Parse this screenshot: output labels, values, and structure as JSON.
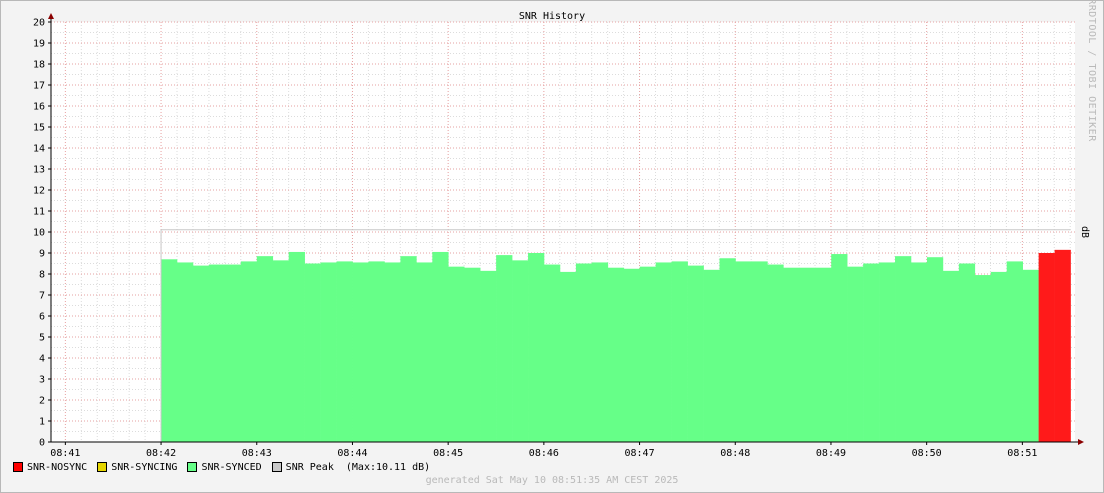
{
  "window": {
    "title": "SNR History",
    "unit_label": "dB",
    "watermark": "RRDTOOL / TOBI OETIKER",
    "footer": "generated Sat May 10 08:51:35 AM CEST 2025"
  },
  "colors": {
    "background": "#f3f3f3",
    "canvas": "#ffffff",
    "grid_major": "#e6a0a0",
    "grid_minor": "#dcdcdc",
    "synced": "#66ff88",
    "nosync": "#ff1a1a",
    "syncing": "#e0d000",
    "peak": "#c8c8c8",
    "axis": "#000000",
    "arrow": "#8b0000"
  },
  "legend": [
    {
      "label": "SNR-NOSYNC",
      "color": "#ff0000"
    },
    {
      "label": "SNR-SYNCING",
      "color": "#e6d600"
    },
    {
      "label": "SNR-SYNCED",
      "color": "#66ff88"
    },
    {
      "label": "SNR Peak  (Max:10.11 dB)",
      "color": "#c8c8c8"
    }
  ],
  "chart_data": {
    "type": "bar",
    "title": "SNR History",
    "ylabel": "dB",
    "ylim": [
      0,
      20
    ],
    "y_ticks": [
      0,
      1,
      2,
      3,
      4,
      5,
      6,
      7,
      8,
      9,
      10,
      11,
      12,
      13,
      14,
      15,
      16,
      17,
      18,
      19,
      20
    ],
    "x_range_minutes": [
      8.525,
      9.1
    ],
    "x_ticks": [
      {
        "label": "08:41",
        "value": 41
      },
      {
        "label": "08:42",
        "value": 42
      },
      {
        "label": "08:43",
        "value": 43
      },
      {
        "label": "08:44",
        "value": 44
      },
      {
        "label": "08:45",
        "value": 45
      },
      {
        "label": "08:46",
        "value": 46
      },
      {
        "label": "08:47",
        "value": 47
      },
      {
        "label": "08:48",
        "value": 48
      },
      {
        "label": "08:49",
        "value": 49
      },
      {
        "label": "08:50",
        "value": 50
      },
      {
        "label": "08:51",
        "value": 51
      }
    ],
    "peak": 10.11,
    "series": [
      {
        "name": "SNR-SYNCED",
        "values": [
          8.7,
          8.55,
          8.4,
          8.45,
          8.45,
          8.6,
          8.85,
          8.65,
          9.05,
          8.5,
          8.55,
          8.6,
          8.55,
          8.6,
          8.55,
          8.85,
          8.55,
          9.05,
          8.35,
          8.3,
          8.15,
          8.9,
          8.65,
          9.0,
          8.45,
          8.1,
          8.5,
          8.55,
          8.3,
          8.25,
          8.35,
          8.55,
          8.6,
          8.4,
          8.2,
          8.75,
          8.6,
          8.6,
          8.45,
          8.3,
          8.3,
          8.3,
          8.95,
          8.35,
          8.5,
          8.55,
          8.85,
          8.55,
          8.8,
          8.15,
          8.5,
          7.95,
          8.1,
          8.6,
          8.2
        ]
      },
      {
        "name": "SNR-NOSYNC",
        "values": [
          9.0,
          9.15
        ]
      }
    ]
  }
}
